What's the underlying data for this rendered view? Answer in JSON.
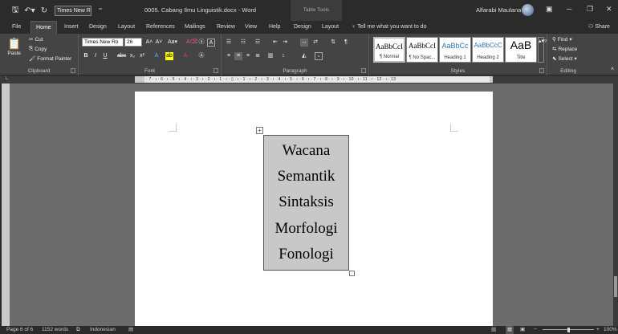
{
  "qat": {
    "font_name": "Times New R"
  },
  "window": {
    "title": "0005. Cabang Ilmu Linguistik.docx  -  Word",
    "contextual_tab": "Table Tools",
    "user": "Alfarabi Maulana"
  },
  "tabs": [
    "File",
    "Home",
    "Insert",
    "Design",
    "Layout",
    "References",
    "Mailings",
    "Review",
    "View",
    "Help",
    "Design",
    "Layout"
  ],
  "tell_me": "Tell me what you want to do",
  "share": "Share",
  "clipboard": {
    "paste": "Paste",
    "cut": "Cut",
    "copy": "Copy",
    "format_painter": "Format Painter",
    "label": "Clipboard"
  },
  "font": {
    "name": "Times New Ro",
    "size": "26",
    "label": "Font"
  },
  "paragraph": {
    "label": "Paragraph"
  },
  "styles": {
    "label": "Styles",
    "items": [
      {
        "sample": "AaBbCcI",
        "name": "¶ Normal"
      },
      {
        "sample": "AaBbCcI",
        "name": "¶ No Spac..."
      },
      {
        "sample": "AaBbCc",
        "name": "Heading 1"
      },
      {
        "sample": "AaBbCcC",
        "name": "Heading 2"
      },
      {
        "sample": "AaB",
        "name": "Title"
      }
    ]
  },
  "editing": {
    "find": "Find",
    "replace": "Replace",
    "select": "Select",
    "label": "Editing"
  },
  "ruler": {
    "numbers": "· 7 · ı · 6 · ı · 5 · ı · 4 · ı · 3 · ı · 2 · ı · 1 · ı · ▯ · ı · 1 · ı · 2 · ı · 3 · ı · 4 · ı · 5 · ı · 6 · ı · 7 · ı · 8 · ı · 9 · ı · 10 · ı · 11 · ı · 12 · ı · 13"
  },
  "document": {
    "table_rows": [
      "Wacana",
      "Semantik",
      "Sintaksis",
      "Morfologi",
      "Fonologi"
    ]
  },
  "status": {
    "page": "Page 6 of 6",
    "words": "1152 words",
    "language": "Indonesian",
    "zoom": "100%"
  }
}
